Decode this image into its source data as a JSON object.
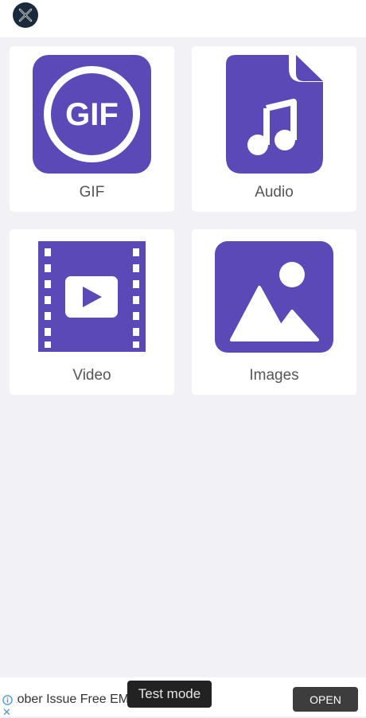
{
  "header": {
    "logo_icon": "close-circle-icon",
    "logo_color": "#1a2a3a"
  },
  "accent_color": "#5a49b6",
  "grid": {
    "items": [
      {
        "label": "GIF",
        "icon": "gif-icon"
      },
      {
        "label": "Audio",
        "icon": "audio-file-icon"
      },
      {
        "label": "Video",
        "icon": "video-film-icon"
      },
      {
        "label": "Images",
        "icon": "image-icon"
      }
    ]
  },
  "ad": {
    "text": "ctober Issue Free EMa",
    "badge": "Test mode",
    "open_label": "OPEN"
  }
}
